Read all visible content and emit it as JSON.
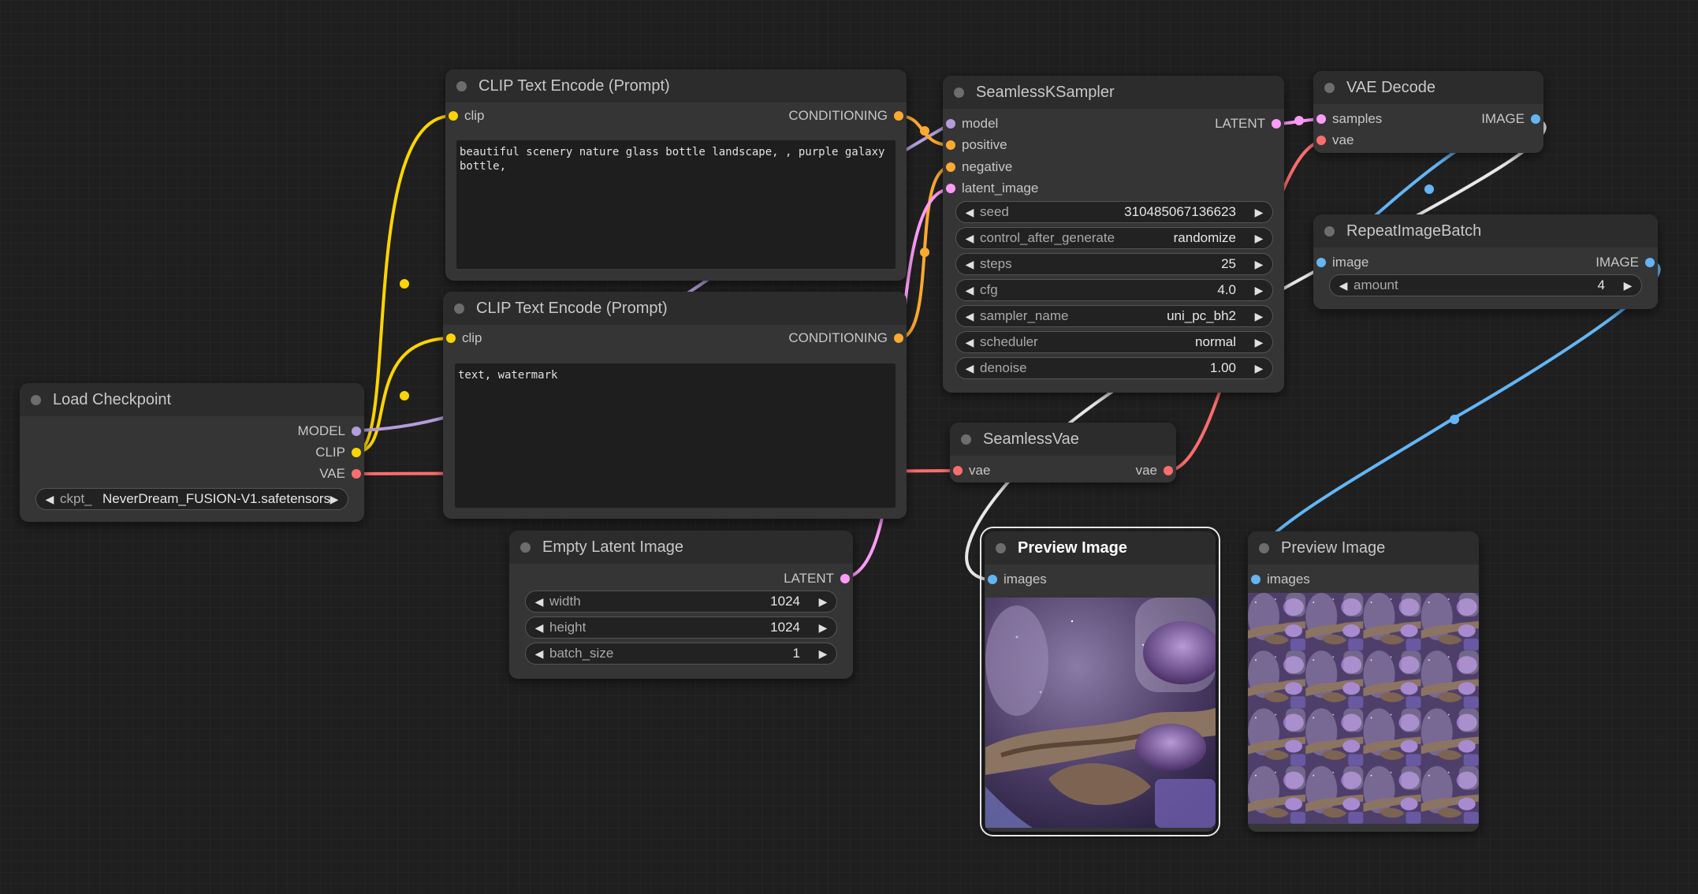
{
  "colors": {
    "clip": "#ffd500",
    "conditioning": "#ffa931",
    "model": "#b39ddb",
    "vae": "#ff6e6e",
    "latent": "#ff9cf9",
    "image": "#64b5f6",
    "link_white": "#e8e8e8"
  },
  "nodes": {
    "load_checkpoint": {
      "title": "Load Checkpoint",
      "outputs": [
        "MODEL",
        "CLIP",
        "VAE"
      ],
      "ckpt_label": "ckpt_",
      "ckpt_value": "NeverDream_FUSION-V1.safetensors"
    },
    "clip_text_encode_positive": {
      "title": "CLIP Text Encode (Prompt)",
      "input": "clip",
      "output": "CONDITIONING",
      "text": "beautiful scenery nature glass bottle landscape, , purple galaxy bottle,"
    },
    "clip_text_encode_negative": {
      "title": "CLIP Text Encode (Prompt)",
      "input": "clip",
      "output": "CONDITIONING",
      "text": "text, watermark"
    },
    "empty_latent_image": {
      "title": "Empty Latent Image",
      "output": "LATENT",
      "widgets": [
        {
          "label": "width",
          "value": "1024"
        },
        {
          "label": "height",
          "value": "1024"
        },
        {
          "label": "batch_size",
          "value": "1"
        }
      ]
    },
    "seamless_ksampler": {
      "title": "SeamlessKSampler",
      "inputs": [
        "model",
        "positive",
        "negative",
        "latent_image"
      ],
      "output": "LATENT",
      "widgets": [
        {
          "label": "seed",
          "value": "310485067136623"
        },
        {
          "label": "control_after_generate",
          "value": "randomize"
        },
        {
          "label": "steps",
          "value": "25"
        },
        {
          "label": "cfg",
          "value": "4.0"
        },
        {
          "label": "sampler_name",
          "value": "uni_pc_bh2"
        },
        {
          "label": "scheduler",
          "value": "normal"
        },
        {
          "label": "denoise",
          "value": "1.00"
        }
      ]
    },
    "seamless_vae": {
      "title": "SeamlessVae",
      "input": "vae",
      "output": "vae"
    },
    "vae_decode": {
      "title": "VAE Decode",
      "inputs": [
        "samples",
        "vae"
      ],
      "output": "IMAGE"
    },
    "repeat_image_batch": {
      "title": "RepeatImageBatch",
      "input": "image",
      "output": "IMAGE",
      "widgets": [
        {
          "label": "amount",
          "value": "4"
        }
      ]
    },
    "preview_image_1": {
      "title": "Preview Image",
      "input": "images"
    },
    "preview_image_2": {
      "title": "Preview Image",
      "input": "images"
    }
  }
}
